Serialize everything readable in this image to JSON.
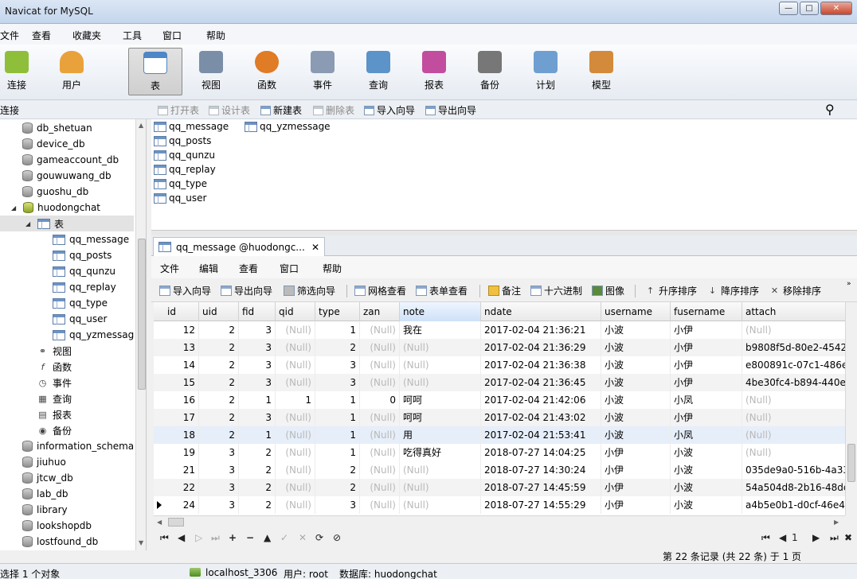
{
  "window": {
    "title": "Navicat for MySQL"
  },
  "menubar": [
    "文件",
    "查看",
    "收藏夹",
    "工具",
    "窗口",
    "帮助"
  ],
  "toolbar": [
    {
      "label": "连接",
      "icon": "connect-icon",
      "color": "#8fbf3a"
    },
    {
      "label": "用户",
      "icon": "user-icon",
      "color": "#e9a23b"
    },
    {
      "label": "表",
      "icon": "table-icon",
      "color": "#4f86c6"
    },
    {
      "label": "视图",
      "icon": "view-icon",
      "color": "#7b8ea8"
    },
    {
      "label": "函数",
      "icon": "function-icon",
      "color": "#e07b26"
    },
    {
      "label": "事件",
      "icon": "event-icon",
      "color": "#8a9bb3"
    },
    {
      "label": "查询",
      "icon": "query-icon",
      "color": "#5c93c9"
    },
    {
      "label": "报表",
      "icon": "report-icon",
      "color": "#c24d9e"
    },
    {
      "label": "备份",
      "icon": "backup-icon",
      "color": "#777777"
    },
    {
      "label": "计划",
      "icon": "schedule-icon",
      "color": "#6f9fd1"
    },
    {
      "label": "模型",
      "icon": "model-icon",
      "color": "#d38a3a"
    }
  ],
  "sidebar": {
    "header": "连接",
    "databases_top": [
      "db_shetuan",
      "device_db",
      "gameaccount_db",
      "gouwuwang_db",
      "guoshu_db"
    ],
    "open_db": "huodongchat",
    "tables_node": "表",
    "tables": [
      "qq_message",
      "qq_posts",
      "qq_qunzu",
      "qq_replay",
      "qq_type",
      "qq_user",
      "qq_yzmessag"
    ],
    "other_nodes": [
      {
        "label": "视图",
        "icon": "glasses-icon"
      },
      {
        "label": "函数",
        "icon": "function-icon"
      },
      {
        "label": "事件",
        "icon": "event-icon"
      },
      {
        "label": "查询",
        "icon": "query-icon"
      },
      {
        "label": "报表",
        "icon": "report-icon"
      },
      {
        "label": "备份",
        "icon": "backup-icon"
      }
    ],
    "databases_bottom": [
      "information_schema",
      "jiuhuo",
      "jtcw_db",
      "lab_db",
      "library",
      "lookshopdb",
      "lostfound_db"
    ]
  },
  "objbar": [
    {
      "label": "打开表",
      "enabled": false
    },
    {
      "label": "设计表",
      "enabled": false
    },
    {
      "label": "新建表",
      "enabled": true
    },
    {
      "label": "删除表",
      "enabled": false
    },
    {
      "label": "导入向导",
      "enabled": true
    },
    {
      "label": "导出向导",
      "enabled": true
    }
  ],
  "objects": [
    "qq_message",
    "qq_yzmessage",
    "qq_posts",
    "qq_qunzu",
    "qq_replay",
    "qq_type",
    "qq_user"
  ],
  "tab": {
    "label": "qq_message @huodongc..."
  },
  "inner_menu": [
    "文件",
    "编辑",
    "查看",
    "窗口",
    "帮助"
  ],
  "gridbar": [
    "导入向导",
    "导出向导",
    "筛选向导",
    "网格查看",
    "表单查看",
    "备注",
    "十六进制",
    "图像",
    "升序排序",
    "降序排序",
    "移除排序"
  ],
  "grid": {
    "columns": [
      "id",
      "uid",
      "fid",
      "qid",
      "type",
      "zan",
      "note",
      "ndate",
      "username",
      "fusername",
      "attach"
    ],
    "null_text": "(Null)",
    "rows": [
      [
        "12",
        "2",
        "3",
        "(Null)",
        "1",
        "(Null)",
        "我在",
        "2017-02-04 21:36:21",
        "小波",
        "小伊",
        "(Null)"
      ],
      [
        "13",
        "2",
        "3",
        "(Null)",
        "2",
        "(Null)",
        "(Null)",
        "2017-02-04 21:36:29",
        "小波",
        "小伊",
        "b9808f5d-80e2-4542"
      ],
      [
        "14",
        "2",
        "3",
        "(Null)",
        "3",
        "(Null)",
        "(Null)",
        "2017-02-04 21:36:38",
        "小波",
        "小伊",
        "e800891c-07c1-486e"
      ],
      [
        "15",
        "2",
        "3",
        "(Null)",
        "3",
        "(Null)",
        "(Null)",
        "2017-02-04 21:36:45",
        "小波",
        "小伊",
        "4be30fc4-b894-440e"
      ],
      [
        "16",
        "2",
        "1",
        "1",
        "1",
        "0",
        "呵呵",
        "2017-02-04 21:42:06",
        "小波",
        "小凤",
        "(Null)"
      ],
      [
        "17",
        "2",
        "3",
        "(Null)",
        "1",
        "(Null)",
        "呵呵",
        "2017-02-04 21:43:02",
        "小波",
        "小伊",
        "(Null)"
      ],
      [
        "18",
        "2",
        "1",
        "(Null)",
        "1",
        "(Null)",
        "用",
        "2017-02-04 21:53:41",
        "小波",
        "小凤",
        "(Null)"
      ],
      [
        "19",
        "3",
        "2",
        "(Null)",
        "1",
        "(Null)",
        "吃得真好",
        "2018-07-27 14:04:25",
        "小伊",
        "小波",
        "(Null)"
      ],
      [
        "21",
        "3",
        "2",
        "(Null)",
        "2",
        "(Null)",
        "(Null)",
        "2018-07-27 14:30:24",
        "小伊",
        "小波",
        "035de9a0-516b-4a33"
      ],
      [
        "22",
        "3",
        "2",
        "(Null)",
        "2",
        "(Null)",
        "(Null)",
        "2018-07-27 14:45:59",
        "小伊",
        "小波",
        "54a504d8-2b16-48dc"
      ],
      [
        "24",
        "3",
        "2",
        "(Null)",
        "3",
        "(Null)",
        "(Null)",
        "2018-07-27 14:55:29",
        "小伊",
        "小波",
        "a4b5e0b1-d0cf-46e4"
      ]
    ]
  },
  "record_info": "第 22 条记录 (共 22 条) 于 1 页",
  "page_number": "1",
  "statusbar": {
    "selection": "选择 1 个对象",
    "connection": "localhost_3306",
    "user": "用户: root",
    "database": "数据库: huodongchat"
  }
}
